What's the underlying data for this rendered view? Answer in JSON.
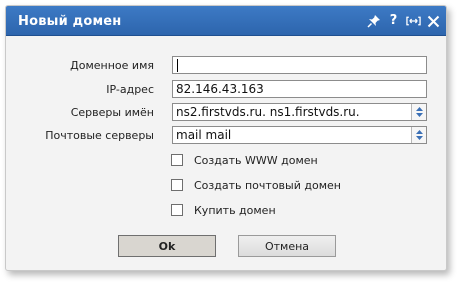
{
  "dialog": {
    "title": "Новый домен",
    "title_icons": [
      "pin-icon",
      "help-icon",
      "resize-icon",
      "close-icon"
    ],
    "help_glyph": "?"
  },
  "form": {
    "domain_name": {
      "label": "Доменное имя",
      "value": ""
    },
    "ip_address": {
      "label": "IP-адрес",
      "value": "82.146.43.163"
    },
    "name_servers": {
      "label": "Серверы имён",
      "value": "ns2.firstvds.ru. ns1.firstvds.ru."
    },
    "mail_servers": {
      "label": "Почтовые серверы",
      "value": "mail mail"
    }
  },
  "options": [
    {
      "label": "Создать WWW домен",
      "checked": false
    },
    {
      "label": "Создать почтовый домен",
      "checked": false
    },
    {
      "label": "Купить домен",
      "checked": false
    }
  ],
  "buttons": {
    "ok": "Ok",
    "cancel": "Отмена"
  },
  "colors": {
    "titlebar": "#2d65ad",
    "dialog_bg": "#f3f3f3",
    "ok_bg": "#d9d6d0"
  }
}
